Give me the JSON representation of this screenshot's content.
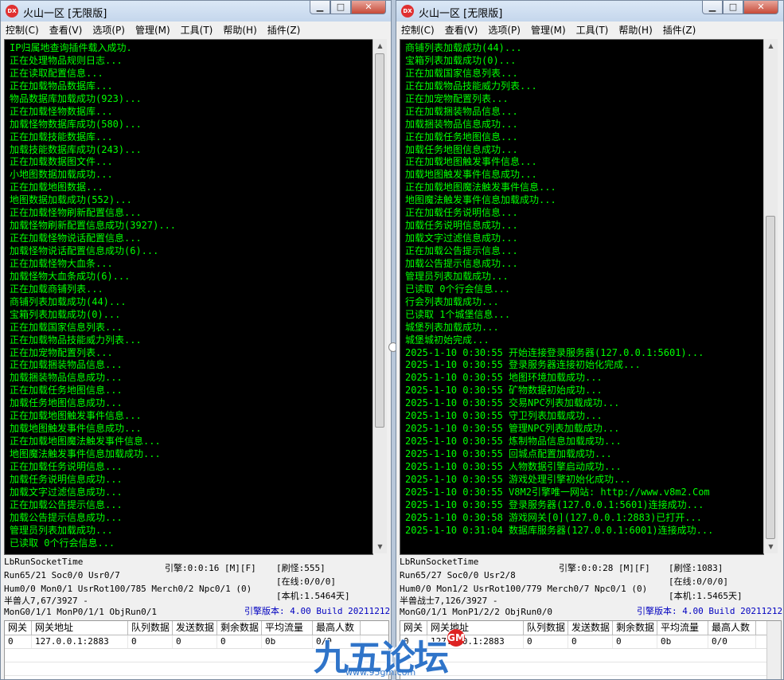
{
  "app_icon_text": "DX",
  "watermark": {
    "text": "九五论坛",
    "url": "www.95gm.com",
    "badge": "GM"
  },
  "windows": [
    {
      "title": "火山一区 [无限版]",
      "menu": [
        "控制(C)",
        "查看(V)",
        "选项(P)",
        "管理(M)",
        "工具(T)",
        "帮助(H)",
        "插件(Z)"
      ],
      "log": [
        "IP归属地查询插件载入成功.",
        "正在处理物品规则日志...",
        "正在读取配置信息...",
        "正在加载物品数据库...",
        "物品数据库加载成功(923)...",
        "正在加载怪物数据库...",
        "加载怪物数据库成功(580)...",
        "正在加载技能数据库...",
        "加载技能数据库成功(243)...",
        "正在加载数据图文件...",
        "小地图数据加载成功...",
        "正在加载地图数据...",
        "地图数据加载成功(552)...",
        "正在加载怪物刷新配置信息...",
        "加载怪物刷新配置信息成功(3927)...",
        "正在加载怪物说话配置信息...",
        "加载怪物说话配置信息成功(6)...",
        "正在加载怪物大血条...",
        "加载怪物大血条成功(6)...",
        "正在加载商铺列表...",
        "商铺列表加载成功(44)...",
        "宝箱列表加载成功(0)...",
        "正在加载国家信息列表...",
        "正在加载物品技能威力列表...",
        "正在加宠物配置列表...",
        "正在加载捆装物品信息...",
        "加载捆装物品信息成功...",
        "正在加载任务地图信息...",
        "加载任务地图信息成功...",
        "正在加载地图触发事件信息...",
        "加载地图触发事件信息成功...",
        "正在加载地图魔法触发事件信息...",
        "地图魔法触发事件信息加载成功...",
        "正在加载任务说明信息...",
        "加载任务说明信息成功...",
        "加载文字过滤信息成功...",
        "正在加载公告提示信息...",
        "加载公告提示信息成功...",
        "管理员列表加载成功...",
        "已读取 0个行会信息..."
      ],
      "status": {
        "socket": "LbRunSocketTime",
        "run": "Run65/21 Soc0/0 Usr0/7",
        "hum": "Hum0/0 Mon0/1 UsrRot100/785 Merch0/2 Npc0/1 (0)",
        "beast": "半兽人7,67/3927 -",
        "mon": "MonG0/1/1 MonP0/1/1 ObjRun0/1",
        "engine": "引擎:0:0:16 [M][F]",
        "refresh": "[刷怪:555]",
        "online": "[在线:0/0/0]",
        "uptime": "[本机:1.5464天]",
        "version": "引擎版本: 4.00 Build 20211212"
      },
      "grid": {
        "headers": [
          "网关",
          "网关地址",
          "队列数据",
          "发送数据",
          "剩余数据",
          "平均流量",
          "最高人数"
        ],
        "rows": [
          [
            "0",
            "127.0.0.1:2883",
            "0",
            "0",
            "0",
            "0b",
            "0/0"
          ]
        ]
      }
    },
    {
      "title": "火山一区 [无限版]",
      "menu": [
        "控制(C)",
        "查看(V)",
        "选项(P)",
        "管理(M)",
        "工具(T)",
        "帮助(H)",
        "插件(Z)"
      ],
      "log": [
        "商铺列表加载成功(44)...",
        "宝箱列表加载成功(0)...",
        "正在加载国家信息列表...",
        "正在加载物品技能威力列表...",
        "正在加宠物配置列表...",
        "正在加载捆装物品信息...",
        "加载捆装物品信息成功...",
        "正在加载任务地图信息...",
        "加载任务地图信息成功...",
        "正在加载地图触发事件信息...",
        "加载地图触发事件信息成功...",
        "正在加载地图魔法触发事件信息...",
        "地图魔法触发事件信息加载成功...",
        "正在加载任务说明信息...",
        "加载任务说明信息成功...",
        "加载文字过滤信息成功...",
        "正在加载公告提示信息...",
        "加载公告提示信息成功...",
        "管理员列表加载成功...",
        "已读取 0个行会信息...",
        "行会列表加载成功...",
        "已读取 1个城堡信息...",
        "城堡列表加载成功...",
        "城堡城初始完成...",
        "2025-1-10 0:30:55 开始连接登录服务器(127.0.0.1:5601)...",
        "2025-1-10 0:30:55 登录服务器连接初始化完成...",
        "2025-1-10 0:30:55 地图环境加载成功...",
        "2025-1-10 0:30:55 矿物数据初始成功...",
        "2025-1-10 0:30:55 交易NPC列表加载成功...",
        "2025-1-10 0:30:55 守卫列表加载成功...",
        "2025-1-10 0:30:55 管理NPC列表加载成功...",
        "2025-1-10 0:30:55 炼制物品信息加载成功...",
        "2025-1-10 0:30:55 回城点配置加载成功...",
        "2025-1-10 0:30:55 人物数据引擎启动成功...",
        "2025-1-10 0:30:55 游戏处理引擎初始化成功...",
        "2025-1-10 0:30:55 V8M2引擎唯一网站: http://www.v8m2.Com",
        "2025-1-10 0:30:55 登录服务器(127.0.0.1:5601)连接成功...",
        "2025-1-10 0:30:58 游戏网关[0](127.0.0.1:2883)已打开...",
        "2025-1-10 0:31:04 数据库服务器(127.0.0.1:6001)连接成功..."
      ],
      "status": {
        "socket": "LbRunSocketTime",
        "run": "Run65/27 Soc0/0 Usr2/8",
        "hum": "Hum0/0 Mon1/2 UsrRot100/779 Merch0/7 Npc0/1 (0)",
        "beast": "半兽战士7,126/3927 -",
        "mon": "MonG0/1/1 MonP1/2/2 ObjRun0/0",
        "engine": "引擎:0:0:28 [M][F]",
        "refresh": "[刷怪:1083]",
        "online": "[在线:0/0/0]",
        "uptime": "[本机:1.5465天]",
        "version": "引擎版本: 4.00 Build 20211212"
      },
      "grid": {
        "headers": [
          "网关",
          "网关地址",
          "队列数据",
          "发送数据",
          "剩余数据",
          "平均流量",
          "最高人数"
        ],
        "rows": [
          [
            "0",
            "127.0.0.1:2883",
            "0",
            "0",
            "0",
            "0b",
            "0/0"
          ]
        ]
      }
    }
  ]
}
